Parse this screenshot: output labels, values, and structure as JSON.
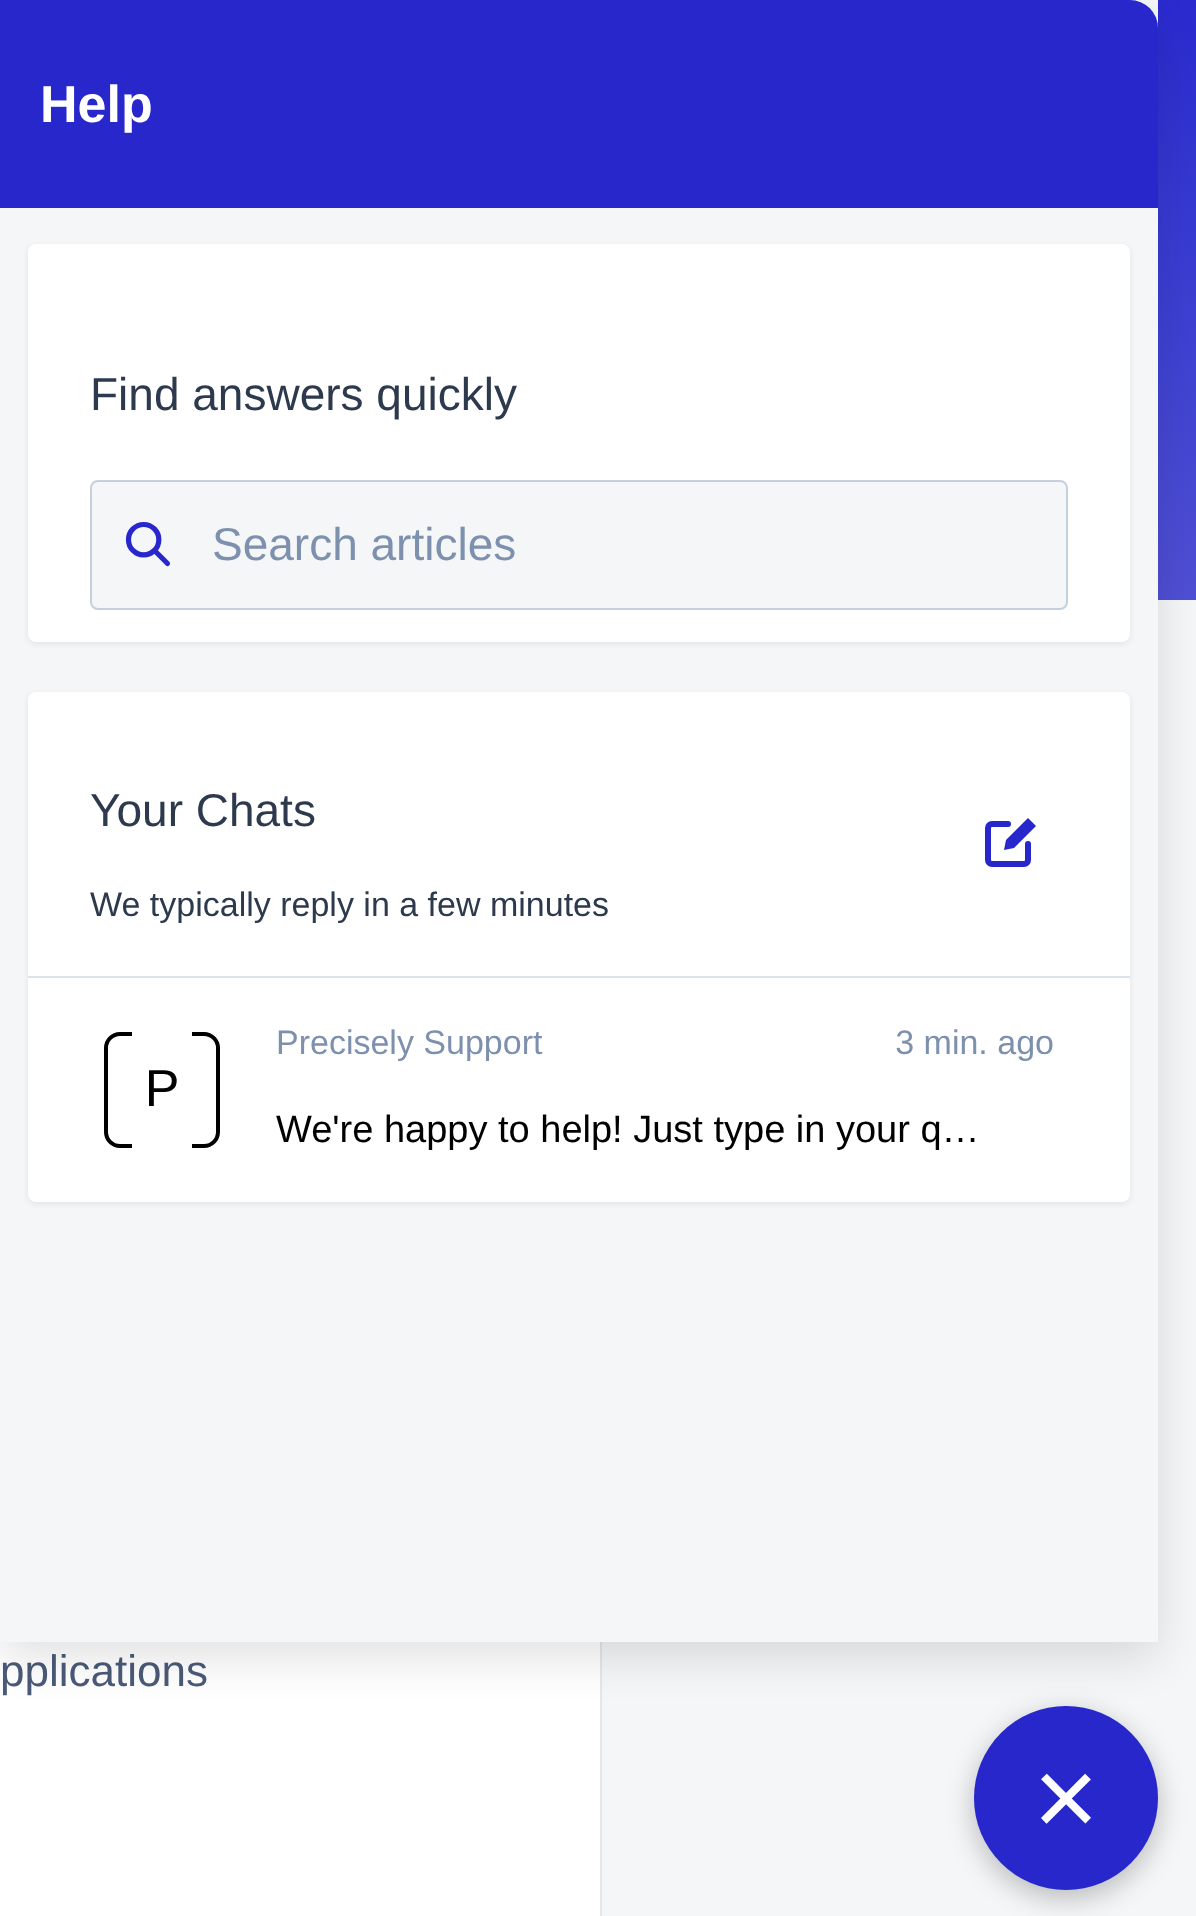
{
  "background_page": {
    "sidebar_text": "pplications"
  },
  "help_panel": {
    "title": "Help",
    "search_card": {
      "heading": "Find answers quickly",
      "search": {
        "placeholder": "Search articles"
      }
    },
    "chats_card": {
      "title": "Your Chats",
      "subtitle": "We typically reply in a few minutes",
      "conversations": [
        {
          "avatar_letter": "P",
          "sender": "Precisely Support",
          "time": "3 min. ago",
          "message": "We're happy to help! Just type in your q…"
        }
      ]
    }
  },
  "close_button": {
    "icon": "×"
  }
}
